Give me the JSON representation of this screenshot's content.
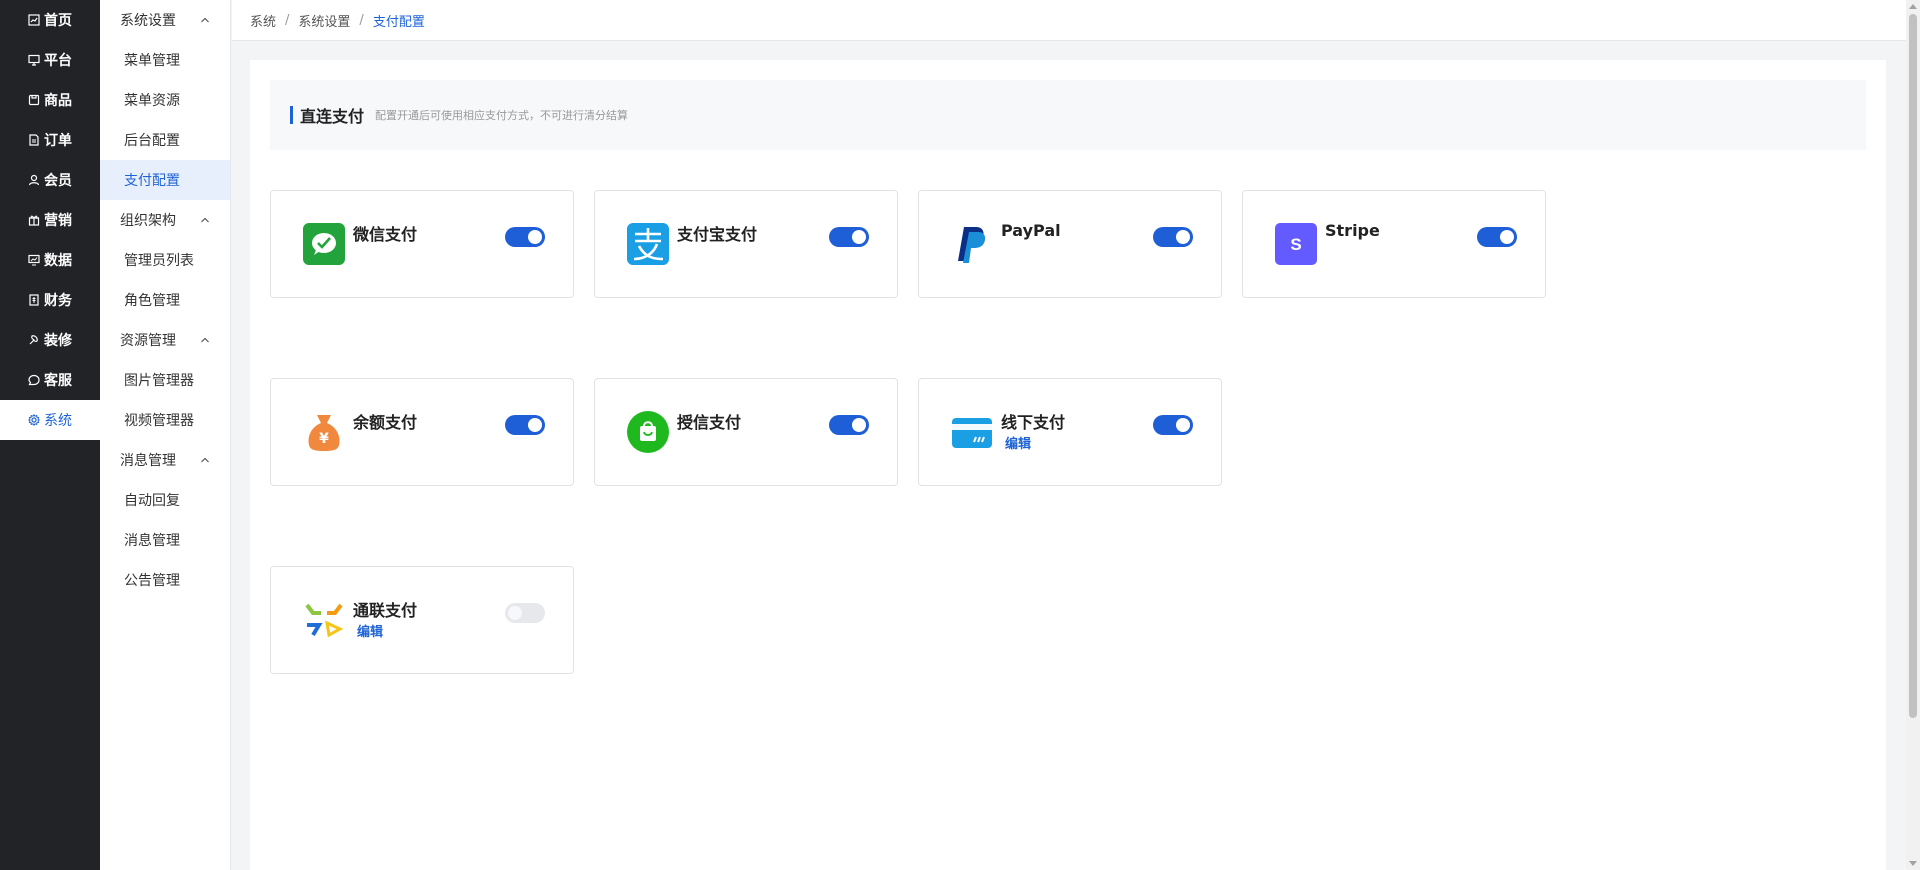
{
  "nav1": [
    {
      "label": "首页",
      "icon": "dashboard-icon"
    },
    {
      "label": "平台",
      "icon": "monitor-icon"
    },
    {
      "label": "商品",
      "icon": "product-icon"
    },
    {
      "label": "订单",
      "icon": "order-icon"
    },
    {
      "label": "会员",
      "icon": "members-icon"
    },
    {
      "label": "营销",
      "icon": "gift-icon"
    },
    {
      "label": "数据",
      "icon": "chart-icon"
    },
    {
      "label": "财务",
      "icon": "finance-icon"
    },
    {
      "label": "装修",
      "icon": "decor-icon"
    },
    {
      "label": "客服",
      "icon": "chat-icon"
    },
    {
      "label": "系统",
      "icon": "gear-icon",
      "active": true
    }
  ],
  "nav2": {
    "groups": [
      {
        "label": "系统设置",
        "items": [
          "菜单管理",
          "菜单资源",
          "后台配置",
          "支付配置"
        ]
      },
      {
        "label": "组织架构",
        "items": [
          "管理员列表",
          "角色管理"
        ]
      },
      {
        "label": "资源管理",
        "items": [
          "图片管理器",
          "视频管理器"
        ]
      },
      {
        "label": "消息管理",
        "items": [
          "自动回复",
          "消息管理",
          "公告管理"
        ]
      }
    ],
    "active_item": "支付配置"
  },
  "breadcrumb": [
    "系统",
    "系统设置",
    "支付配置"
  ],
  "section": {
    "title": "直连支付",
    "desc": "配置开通后可使用相应支付方式，不可进行清分结算"
  },
  "payments": [
    {
      "name": "微信支付",
      "enabled": true,
      "icon": "wechat-pay-icon"
    },
    {
      "name": "支付宝支付",
      "enabled": true,
      "icon": "alipay-icon"
    },
    {
      "name": "PayPal",
      "enabled": true,
      "icon": "paypal-icon"
    },
    {
      "name": "Stripe",
      "enabled": true,
      "icon": "stripe-icon",
      "icon_text": "S"
    },
    {
      "name": "余额支付",
      "enabled": true,
      "icon": "money-bag-icon",
      "icon_text": "¥"
    },
    {
      "name": "授信支付",
      "enabled": true,
      "icon": "shopping-bag-icon"
    },
    {
      "name": "线下支付",
      "enabled": true,
      "icon": "card-icon",
      "edit": "编辑"
    },
    {
      "name": "通联支付",
      "enabled": false,
      "icon": "allinpay-icon",
      "edit": "编辑"
    }
  ],
  "colors": {
    "accent": "#1e63d6",
    "sidebar": "#222327"
  }
}
